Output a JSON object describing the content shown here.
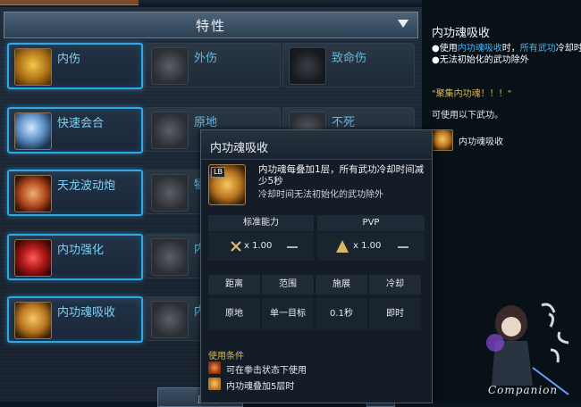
{
  "main": {
    "header_title": "特性",
    "skills": [
      {
        "label": "内伤",
        "active": true
      },
      {
        "label": "外伤",
        "active": false
      },
      {
        "label": "致命伤",
        "active": false
      },
      {
        "label": "快速会合",
        "active": true
      },
      {
        "label": "原地",
        "active": false
      },
      {
        "label": "不死",
        "active": false
      },
      {
        "label": "天龙波动炮",
        "active": true
      },
      {
        "label": "牺",
        "active": false
      },
      {
        "label": "内功强化",
        "active": true
      },
      {
        "label": "内",
        "active": false
      },
      {
        "label": "内功魂吸收",
        "active": true
      },
      {
        "label": "内",
        "active": false
      }
    ],
    "bottom_button": "应用"
  },
  "right_panel": {
    "title": "内功魂吸收",
    "line1_pre": "●使用",
    "line1_hl1": "内功魂吸收",
    "line1_mid": "时，",
    "line1_hl2": "所有武功",
    "line1_post": "冷却时",
    "line2": "●无法初始化的武功除外",
    "quote": "\"聚集内功魂！！！\"",
    "use_text": "可使用以下武功。",
    "skill_name": "内功魂吸收"
  },
  "tooltip": {
    "title": "内功魂吸收",
    "key_badge": "LB",
    "desc": "内功魂每叠加1层，所有武功冷却时间减少5秒",
    "desc2": "冷却时间无法初始化的武功除外",
    "standard_label": "标准能力",
    "pvp_label": "PVP",
    "standard_mult": "x 1.00",
    "pvp_mult": "x 1.00",
    "headers": [
      "距离",
      "范围",
      "施展",
      "冷却"
    ],
    "values": [
      "原地",
      "单一目标",
      "0.1秒",
      "即时"
    ],
    "cond_title": "使用条件",
    "conditions": [
      "可在拳击状态下使用",
      "内功魂叠加5层时"
    ]
  },
  "companion_label": "Companion",
  "colors": {
    "accent": "#2fa8e8",
    "skill_label": "#7fd0f4",
    "highlight": "#44b8f0",
    "gold": "#d9b85a"
  }
}
